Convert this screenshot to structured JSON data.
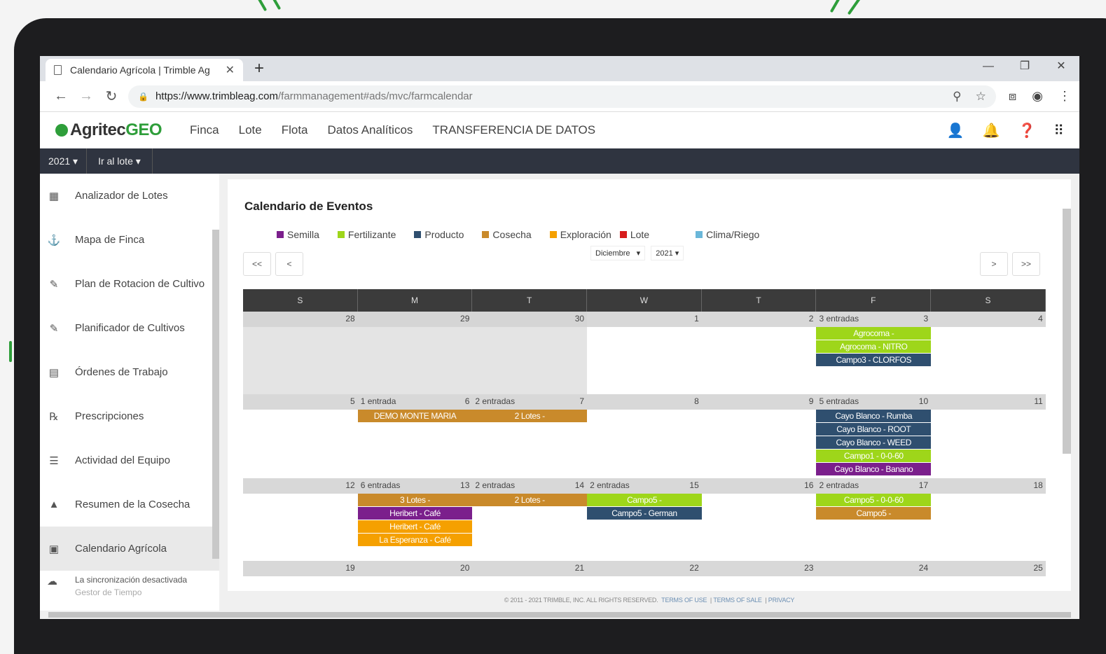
{
  "browser": {
    "tab_title": "Calendario Agrícola | Trimble Ag",
    "url_host": "https://www.trimbleag.com",
    "url_path": "/farmmanagement#ads/mvc/farmcalendar"
  },
  "app": {
    "logo_main": "Agritec",
    "logo_accent": "GEO",
    "nav": [
      "Finca",
      "Lote",
      "Flota",
      "Datos Analíticos",
      "TRANSFERENCIA DE DATOS"
    ],
    "year_dropdown": "2021 ▾",
    "lote_dropdown": "Ir al lote ▾"
  },
  "sidebar": {
    "items": [
      {
        "label": "Analizador de Lotes",
        "icon": "▦"
      },
      {
        "label": "Mapa de Finca",
        "icon": "⚓"
      },
      {
        "label": "Plan de Rotacion de Cultivo",
        "icon": "✎"
      },
      {
        "label": "Planificador de Cultivos",
        "icon": "✎"
      },
      {
        "label": "Órdenes de Trabajo",
        "icon": "▤"
      },
      {
        "label": "Prescripciones",
        "icon": "℞"
      },
      {
        "label": "Actividad del Equipo",
        "icon": "☰"
      },
      {
        "label": "Resumen de la Cosecha",
        "icon": "▲"
      },
      {
        "label": "Calendario Agrícola",
        "icon": "▣"
      }
    ],
    "sync_label": "La sincronización desactivada",
    "sync_sub": "Gestor de Tiempo"
  },
  "calendar": {
    "title": "Calendario de Eventos",
    "legend": [
      {
        "label": "Semilla",
        "color": "#7b1f8c"
      },
      {
        "label": "Fertilizante",
        "color": "#9ed61a"
      },
      {
        "label": "Producto",
        "color": "#2f4f6f"
      },
      {
        "label": "Cosecha",
        "color": "#c98a2b"
      },
      {
        "label": "Exploración",
        "color": "#f5a000"
      },
      {
        "label": "Lote",
        "color": "#d71c1c"
      },
      {
        "label": "Clima/Riego",
        "color": "#6ab7d9"
      }
    ],
    "nav": {
      "first": "<<",
      "prev": "<",
      "next": ">",
      "last": ">>"
    },
    "month": "Diciembre",
    "year": "2021",
    "days": [
      "S",
      "M",
      "T",
      "W",
      "T",
      "F",
      "S"
    ],
    "weeks": [
      {
        "cells": [
          {
            "num": "28",
            "other": true
          },
          {
            "num": "29",
            "other": true
          },
          {
            "num": "30",
            "other": true
          },
          {
            "num": "1"
          },
          {
            "num": "2"
          },
          {
            "num": "3",
            "entries": "3 entradas",
            "events": [
              {
                "text": "Agrocoma -",
                "color": "#9ed61a"
              },
              {
                "text": "Agrocoma - NITRO",
                "color": "#9ed61a"
              },
              {
                "text": "Campo3 - CLORFOS",
                "color": "#2f4f6f"
              }
            ]
          },
          {
            "num": "4"
          }
        ]
      },
      {
        "cells": [
          {
            "num": "5"
          },
          {
            "num": "6",
            "entries": "1 entrada",
            "events": [
              {
                "text": "DEMO MONTE MARIA",
                "color": "#c98a2b"
              }
            ]
          },
          {
            "num": "7",
            "entries": "2 entradas",
            "events": [
              {
                "text": "2 Lotes -",
                "color": "#c98a2b"
              }
            ]
          },
          {
            "num": "8"
          },
          {
            "num": "9"
          },
          {
            "num": "10",
            "entries": "5 entradas",
            "events": [
              {
                "text": "Cayo Blanco - Rumba",
                "color": "#2f4f6f"
              },
              {
                "text": "Cayo Blanco - ROOT",
                "color": "#2f4f6f"
              },
              {
                "text": "Cayo Blanco - WEED",
                "color": "#2f4f6f"
              },
              {
                "text": "Campo1 - 0-0-60",
                "color": "#9ed61a"
              },
              {
                "text": "Cayo Blanco - Banano",
                "color": "#7b1f8c"
              }
            ]
          },
          {
            "num": "11"
          }
        ]
      },
      {
        "cells": [
          {
            "num": "12"
          },
          {
            "num": "13",
            "entries": "6 entradas",
            "events": [
              {
                "text": "3 Lotes -",
                "color": "#c98a2b"
              },
              {
                "text": "Heribert - Café",
                "color": "#7b1f8c"
              },
              {
                "text": "Heribert - Café",
                "color": "#f5a000"
              },
              {
                "text": "La Esperanza - Café",
                "color": "#f5a000"
              }
            ]
          },
          {
            "num": "14",
            "entries": "2 entradas",
            "events": [
              {
                "text": "2 Lotes -",
                "color": "#c98a2b"
              }
            ]
          },
          {
            "num": "15",
            "entries": "2 entradas",
            "events": [
              {
                "text": "Campo5 -",
                "color": "#9ed61a"
              },
              {
                "text": "Campo5 - German",
                "color": "#2f4f6f"
              }
            ]
          },
          {
            "num": "16"
          },
          {
            "num": "17",
            "entries": "2 entradas",
            "events": [
              {
                "text": "Campo5 - 0-0-60",
                "color": "#9ed61a"
              },
              {
                "text": "Campo5 -",
                "color": "#c98a2b"
              }
            ]
          },
          {
            "num": "18"
          }
        ]
      },
      {
        "cells": [
          {
            "num": "19"
          },
          {
            "num": "20"
          },
          {
            "num": "21"
          },
          {
            "num": "22"
          },
          {
            "num": "23"
          },
          {
            "num": "24"
          },
          {
            "num": "25"
          }
        ]
      }
    ]
  },
  "footer": {
    "copyright": "© 2011 - 2021 TRIMBLE, INC. ALL RIGHTS RESERVED.",
    "links": [
      "TERMS OF USE",
      "TERMS OF SALE",
      "PRIVACY"
    ]
  }
}
